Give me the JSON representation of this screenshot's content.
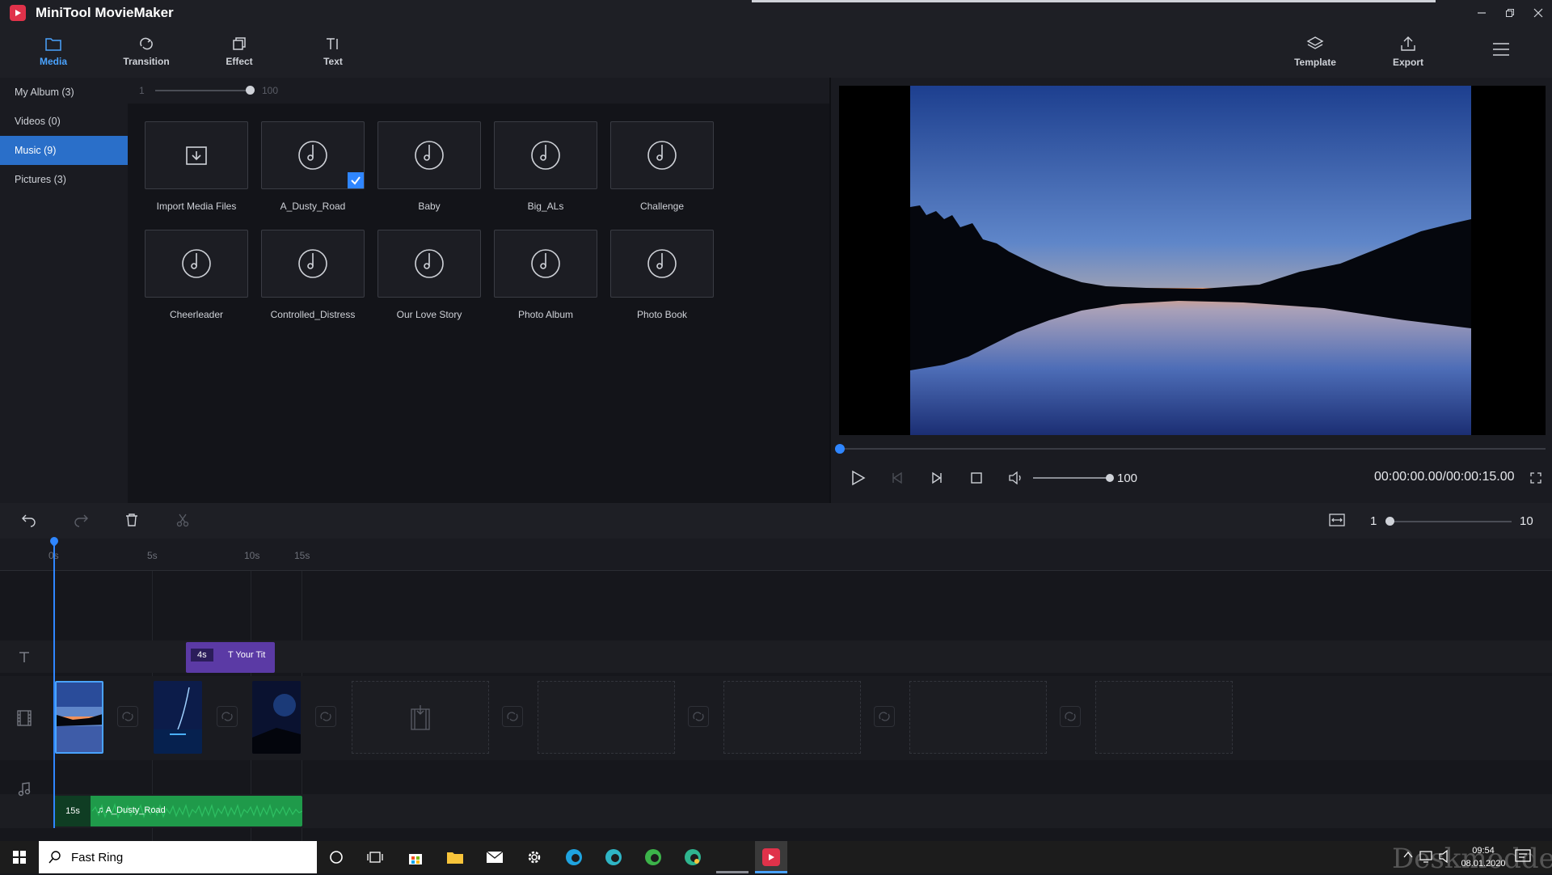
{
  "app": {
    "title": "MiniTool MovieMaker"
  },
  "toolbar": {
    "items": [
      {
        "label": "Media",
        "icon": "folder-icon",
        "active": true
      },
      {
        "label": "Transition",
        "icon": "transition-icon"
      },
      {
        "label": "Effect",
        "icon": "effect-icon"
      },
      {
        "label": "Text",
        "icon": "text-icon"
      }
    ],
    "template_label": "Template",
    "export_label": "Export"
  },
  "sidebar": {
    "items": [
      {
        "label": "My Album  (3)"
      },
      {
        "label": "Videos  (0)"
      },
      {
        "label": "Music  (9)",
        "active": true
      },
      {
        "label": "Pictures  (3)"
      }
    ]
  },
  "media": {
    "zoom_min": "1",
    "zoom_max": "100",
    "zoom_value": 1.0,
    "tiles": [
      {
        "label": "Import Media Files",
        "icon": "import-icon"
      },
      {
        "label": "A_Dusty_Road",
        "icon": "music-disc-icon",
        "checked": true
      },
      {
        "label": "Baby",
        "icon": "music-disc-icon"
      },
      {
        "label": "Big_ALs",
        "icon": "music-disc-icon"
      },
      {
        "label": "Challenge",
        "icon": "music-disc-icon"
      },
      {
        "label": "Cheerleader",
        "icon": "music-disc-icon"
      },
      {
        "label": "Controlled_Distress",
        "icon": "music-disc-icon"
      },
      {
        "label": "Our Love Story",
        "icon": "music-disc-icon"
      },
      {
        "label": "Photo Album",
        "icon": "music-disc-icon"
      },
      {
        "label": "Photo Book",
        "icon": "music-disc-icon"
      }
    ]
  },
  "player": {
    "volume": "100",
    "volume_level": 1.0,
    "time": "00:00:00.00/00:00:15.00",
    "progress": 0.0
  },
  "timeline": {
    "zoom_min": "1",
    "zoom_max": "10",
    "ruler": [
      "0s",
      "5s",
      "10s",
      "15s"
    ],
    "text_clip": {
      "duration": "4s",
      "label": "Your Tit"
    },
    "audio_clip": {
      "duration": "15s",
      "label": "A_Dusty_Road"
    }
  },
  "taskbar": {
    "search_text": "Fast Ring",
    "time": "09:54",
    "date": "08.01.2020",
    "watermark": "Deskmodder.de"
  },
  "colors": {
    "accent": "#2f86ff",
    "text_clip": "#5b3aa5",
    "audio_clip": "#1f9a4a"
  }
}
